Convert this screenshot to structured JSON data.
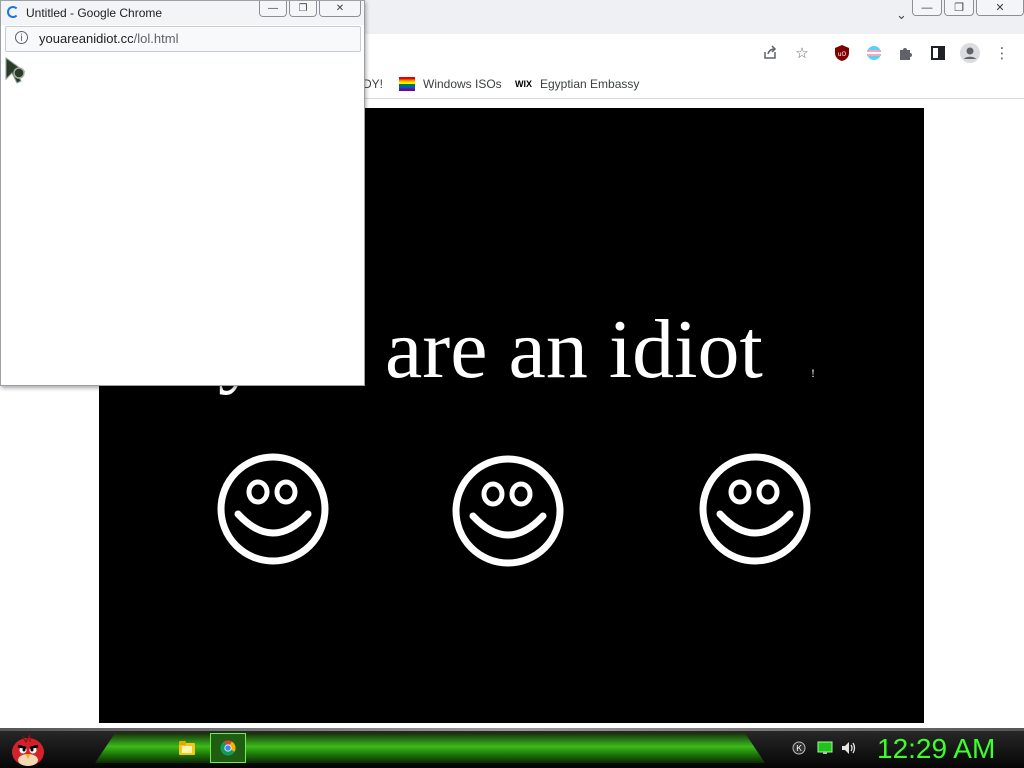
{
  "main_window": {
    "window_controls": {
      "minimize": "—",
      "restore": "❐",
      "close": "✕"
    },
    "bookmarks": [
      {
        "label": "DY!",
        "icon": "none"
      },
      {
        "label": "Windows ISOs",
        "icon": "rainbow-flag-icon"
      },
      {
        "label": "Egyptian Embassy",
        "icon": "wix-icon",
        "icon_text": "WIX"
      }
    ]
  },
  "page": {
    "slogan": "are an idiot",
    "slogan_tail": "!",
    "background": "#000000",
    "foreground": "#ffffff",
    "smiley_count": 3
  },
  "popup": {
    "title": "Untitled - Google Chrome",
    "url_host": "youareanidiot.cc",
    "url_path": "/lol.html",
    "window_controls": {
      "minimize": "—",
      "restore": "❐",
      "close": "✕"
    }
  },
  "taskbar": {
    "clock": "12:29 AM",
    "accent": "#3cff2a"
  }
}
